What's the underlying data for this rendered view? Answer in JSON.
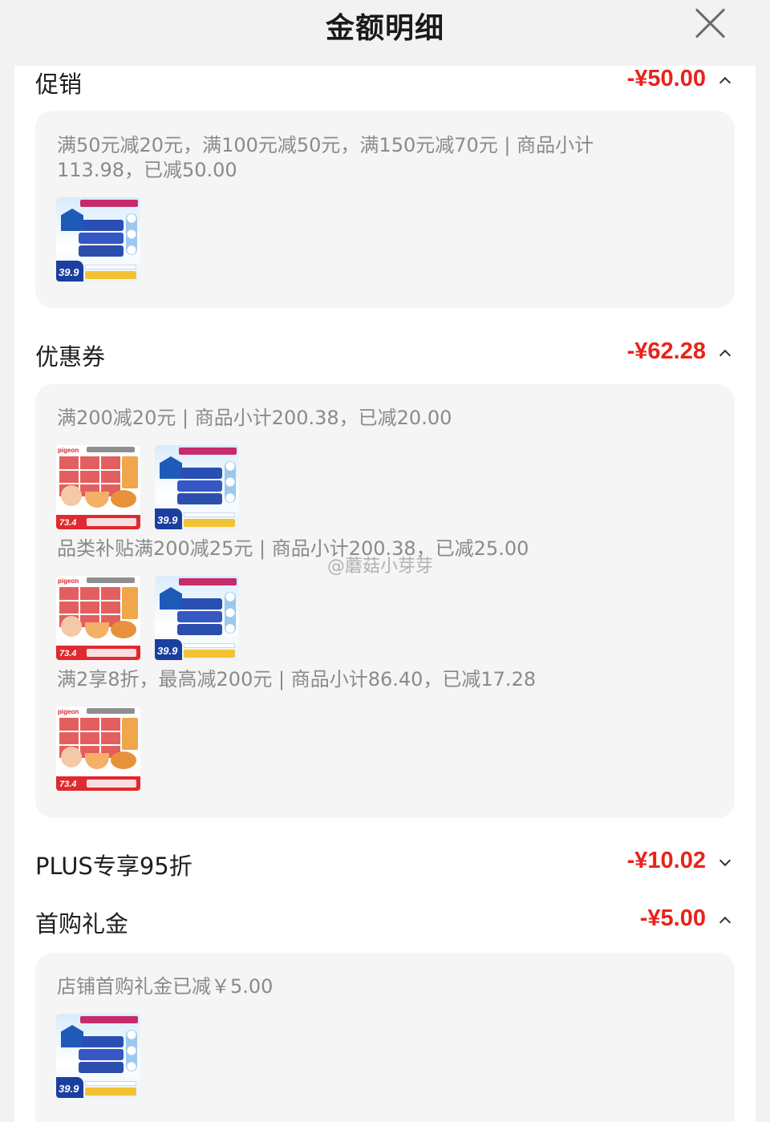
{
  "header": {
    "title": "金额明细"
  },
  "sections": {
    "promotion": {
      "label": "促销",
      "amount": "-¥50.00",
      "description": "满50元减20元，满100元减50元，满150元减70元 | 商品小计113.98，已减50.00"
    },
    "coupon": {
      "label": "优惠券",
      "amount": "-¥62.28",
      "items": [
        "满200减20元 | 商品小计200.38，已减20.00",
        "品类补贴满200减25元 | 商品小计200.38，已减25.00",
        "满2享8折，最高减200元 | 商品小计86.40，已减17.28"
      ]
    },
    "plus": {
      "label": "PLUS专享95折",
      "amount": "-¥10.02"
    },
    "first_purchase": {
      "label": "首购礼金",
      "amount": "-¥5.00",
      "description": "店铺首购礼金已减￥5.00"
    }
  },
  "products": {
    "wipes_price": "39.9",
    "food_price": "73.4",
    "food_brand": "pigeon"
  },
  "watermark": "@蘑菇小芽芽",
  "colors": {
    "accent": "#e8231b",
    "card": "#f5f5f5",
    "muted_text": "#8a8a8a"
  }
}
